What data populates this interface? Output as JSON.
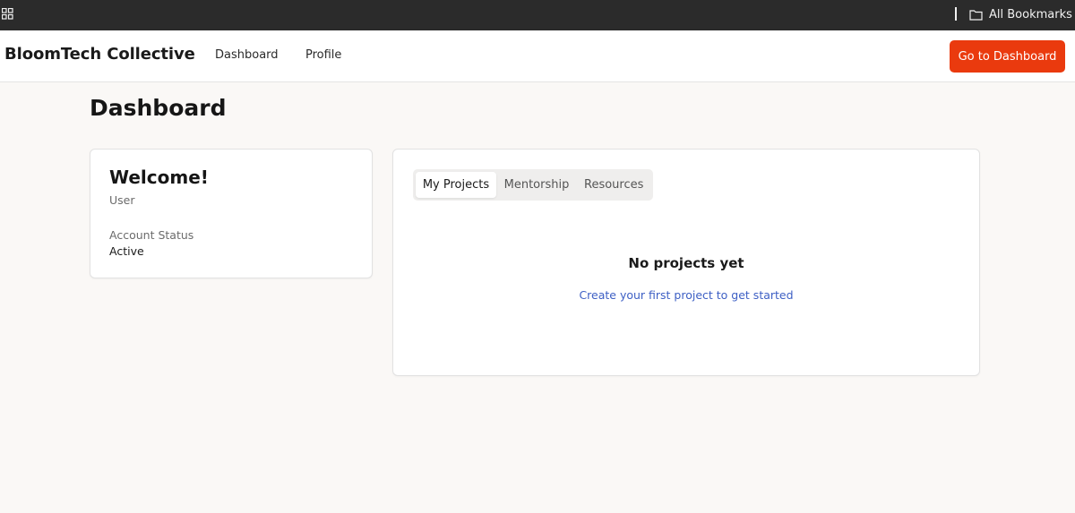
{
  "browser": {
    "all_bookmarks_label": "All Bookmarks"
  },
  "header": {
    "brand": "BloomTech Collective",
    "nav": [
      {
        "label": "Dashboard"
      },
      {
        "label": "Profile"
      }
    ],
    "cta_label": "Go to Dashboard"
  },
  "page": {
    "title": "Dashboard"
  },
  "welcome_card": {
    "title": "Welcome!",
    "role": "User",
    "status_label": "Account Status",
    "status_value": "Active"
  },
  "projects_card": {
    "tabs": [
      {
        "label": "My Projects",
        "active": true
      },
      {
        "label": "Mentorship",
        "active": false
      },
      {
        "label": "Resources",
        "active": false
      }
    ],
    "empty_title": "No projects yet",
    "empty_subtitle": "Create your first project to get started"
  },
  "colors": {
    "accent": "#ea3a0e",
    "link": "#3d5fc4",
    "background": "#faf8f6"
  },
  "icons": [
    "apps-grid-icon",
    "folder-icon"
  ]
}
